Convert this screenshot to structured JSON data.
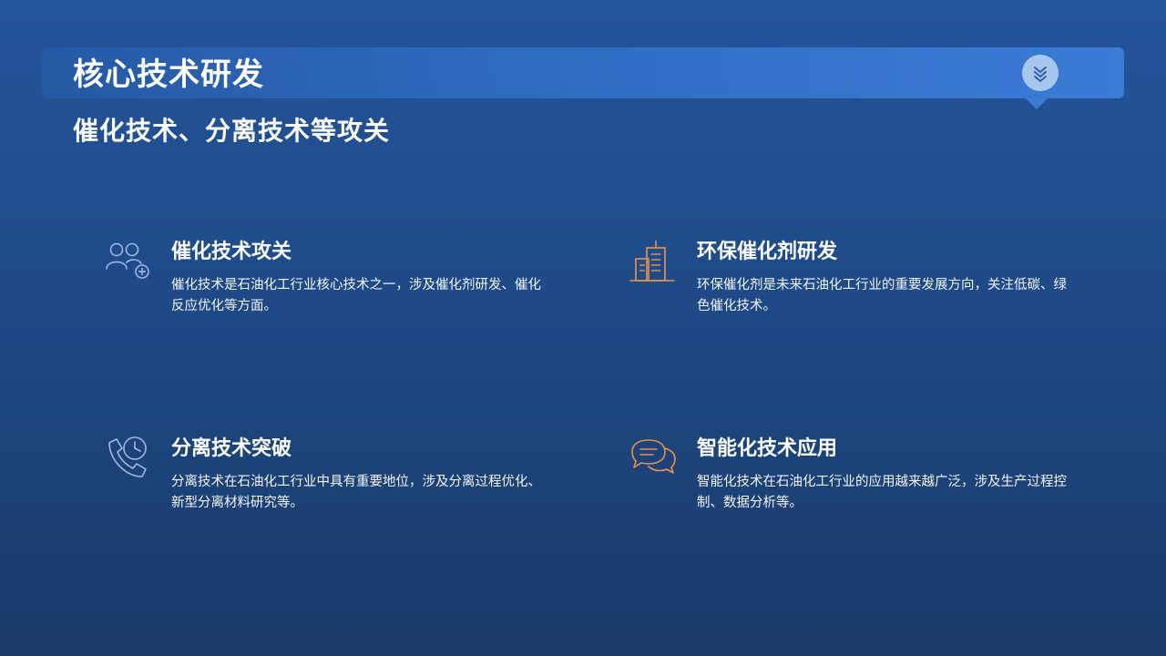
{
  "slide": {
    "title": "核心技术研发",
    "subtitle": "催化技术、分离技术等攻关"
  },
  "header_badge_icon": "double-chevron-down-icon",
  "colors": {
    "accent_blue": "#3a7bd5",
    "icon_light_blue": "#9fb8e3",
    "icon_orange": "#e8924a"
  },
  "features": [
    {
      "icon": "users-add-icon",
      "title": "催化技术攻关",
      "desc": "催化技术是石油化工行业核心技术之一，涉及催化剂研发、催化反应优化等方面。"
    },
    {
      "icon": "buildings-icon",
      "title": "环保催化剂研发",
      "desc": "环保催化剂是未来石油化工行业的重要发展方向，关注低碳、绿色催化技术。"
    },
    {
      "icon": "phone-clock-icon",
      "title": "分离技术突破",
      "desc": "分离技术在石油化工行业中具有重要地位，涉及分离过程优化、新型分离材料研究等。"
    },
    {
      "icon": "chat-bubbles-icon",
      "title": "智能化技术应用",
      "desc": "智能化技术在石油化工行业的应用越来越广泛，涉及生产过程控制、数据分析等。"
    }
  ]
}
